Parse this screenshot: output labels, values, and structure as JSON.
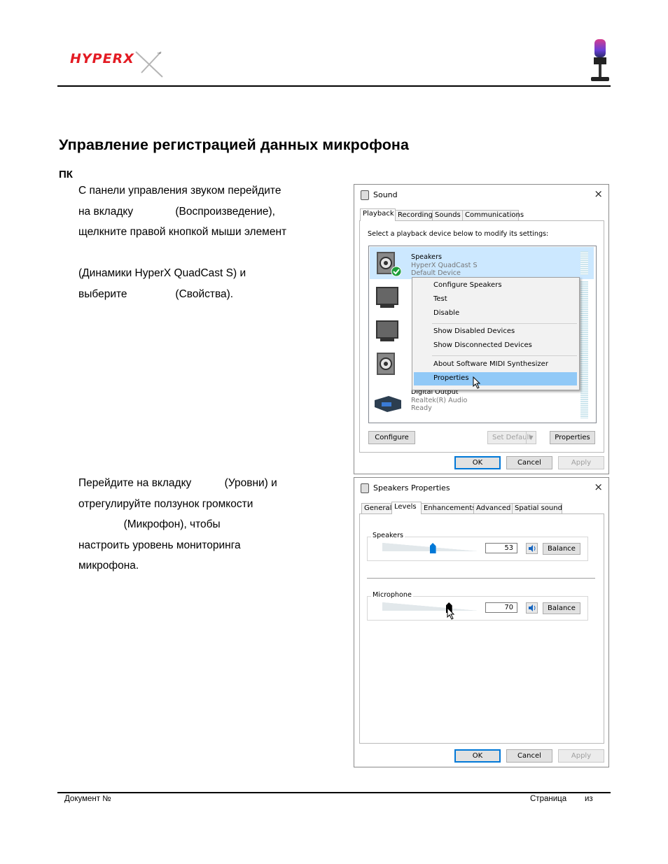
{
  "header": {
    "logo_text": "HYPERX",
    "logo_tm": "™"
  },
  "doc": {
    "title": "Управление регистрацией данных микрофона",
    "section": "ПК",
    "step1_lines": [
      "С панели управления звуком перейдите",
      "на вкладку              (Воспроизведение),",
      "щелкните правой кнопкой мыши элемент",
      "",
      "(Динамики HyperX QuadCast S) и",
      "выберите                (Свойства)."
    ],
    "step2_lines": [
      "Перейдите на вкладку           (Уровни) и",
      "отрегулируйте ползунок громкости",
      "               (Микрофон), чтобы",
      "настроить уровень мониторинга",
      "микрофона."
    ]
  },
  "sound_dialog": {
    "title": "Sound",
    "close": "×",
    "tabs": [
      "Playback",
      "Recording",
      "Sounds",
      "Communications"
    ],
    "instruction": "Select a playback device below to modify its settings:",
    "devices": [
      {
        "name": "Speakers",
        "desc": "HyperX QuadCast S",
        "status": "Default Device"
      },
      {
        "name": "Digital Output",
        "desc": "Realtek(R) Audio",
        "status": "Ready"
      }
    ],
    "context_menu": [
      "Configure Speakers",
      "Test",
      "Disable",
      "Show Disabled Devices",
      "Show Disconnected Devices",
      "About Software MIDI Synthesizer",
      "Properties"
    ],
    "buttons": {
      "configure": "Configure",
      "set_default": "Set Default",
      "properties": "Properties",
      "ok": "OK",
      "cancel": "Cancel",
      "apply": "Apply"
    }
  },
  "props_dialog": {
    "title": "Speakers Properties",
    "close": "×",
    "tabs": [
      "General",
      "Levels",
      "Enhancements",
      "Advanced",
      "Spatial sound"
    ],
    "speakers": {
      "label": "Speakers",
      "value": "53",
      "level": 0.53,
      "balance": "Balance"
    },
    "microphone": {
      "label": "Microphone",
      "value": "70",
      "level": 0.7,
      "balance": "Balance"
    },
    "buttons": {
      "ok": "OK",
      "cancel": "Cancel",
      "apply": "Apply"
    }
  },
  "footer": {
    "left": "Документ №",
    "right_page": "Страница",
    "right_of": "из"
  },
  "colors": {
    "accent": "#0078d7",
    "selection": "#cce8ff",
    "menu_highlight": "#91c9f7",
    "logo_red": "#e31b23"
  }
}
